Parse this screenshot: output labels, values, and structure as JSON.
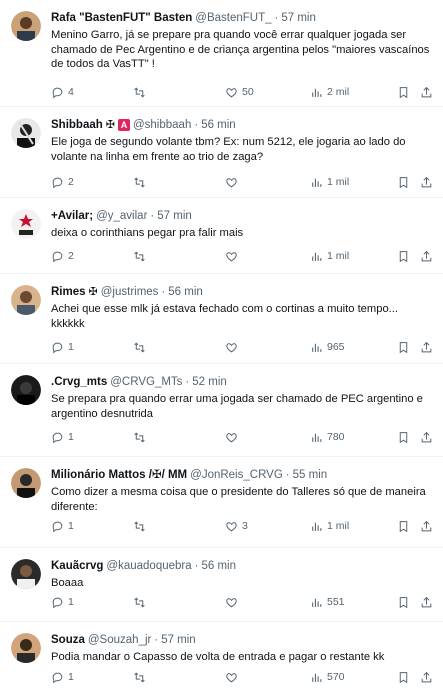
{
  "posts": [
    {
      "display_name": "Rafa \"BastenFUT\" Basten",
      "handle": "@BastenFUT_",
      "time": "57 min",
      "text": "Menino Garro, já se prepare pra quando você errar qualquer jogada ser chamado de Pec Argentino e de criança argentina pelos \"maiores vascaínos de todos da VasTT\" !",
      "replies": "4",
      "retweets": "",
      "likes": "50",
      "views": "2 mil"
    },
    {
      "display_name": "Shibbaah",
      "handle": "@shibbaah",
      "time": "56 min",
      "text": "Ele joga de segundo volante tbm? Ex: num 5212, ele jogaria ao lado do volante na linha em frente ao trio de zaga?",
      "replies": "2",
      "retweets": "",
      "likes": "",
      "views": "1 mil"
    },
    {
      "display_name": "+Avilar;",
      "handle": "@y_avilar",
      "time": "57 min",
      "text": "deixa o corinthians pegar pra falir mais",
      "replies": "2",
      "retweets": "",
      "likes": "",
      "views": "1 mil"
    },
    {
      "display_name": "Rimes",
      "handle": "@justrimes",
      "time": "56 min",
      "text": "Achei que esse mlk já estava fechado com o cortinas a muito tempo... kkkkkk",
      "replies": "1",
      "retweets": "",
      "likes": "",
      "views": "965"
    },
    {
      "display_name": ".Crvg_mts",
      "handle": "@CRVG_MTs",
      "time": "52 min",
      "text": "Se prepara pra quando errar uma jogada ser chamado de PEC argentino e argentino desnutrida",
      "replies": "1",
      "retweets": "",
      "likes": "",
      "views": "780"
    },
    {
      "display_name": "Milionário Mattos /✠/ MM",
      "handle": "@JonReis_CRVG",
      "time": "55 min",
      "text": "Como dizer a mesma coisa que o presidente do Talleres só que de maneira diferente:",
      "replies": "1",
      "retweets": "",
      "likes": "3",
      "views": "1 mil"
    },
    {
      "display_name": "Kauãcrvg",
      "handle": "@kauadoquebra",
      "time": "56 min",
      "text": "Boaaa",
      "replies": "1",
      "retweets": "",
      "likes": "",
      "views": "551"
    },
    {
      "display_name": "Souza",
      "handle": "@Souzah_jr",
      "time": "57 min",
      "text": "Podia mandar o Capasso de volta de entrada e pagar o restante kk",
      "replies": "1",
      "retweets": "",
      "likes": "",
      "views": "570"
    }
  ],
  "badges": {
    "shibbaah_cross": "✠",
    "shibbaah_red": "A",
    "rimes_cross": "✠"
  },
  "separator": "·",
  "icons": [
    "reply-icon",
    "retweet-icon",
    "like-icon",
    "views-icon",
    "bookmark-icon",
    "share-icon"
  ],
  "colors": {
    "text_primary": "#0f1419",
    "text_secondary": "#536471",
    "divider": "#eff3f4",
    "badge_red": "#e0245e"
  }
}
